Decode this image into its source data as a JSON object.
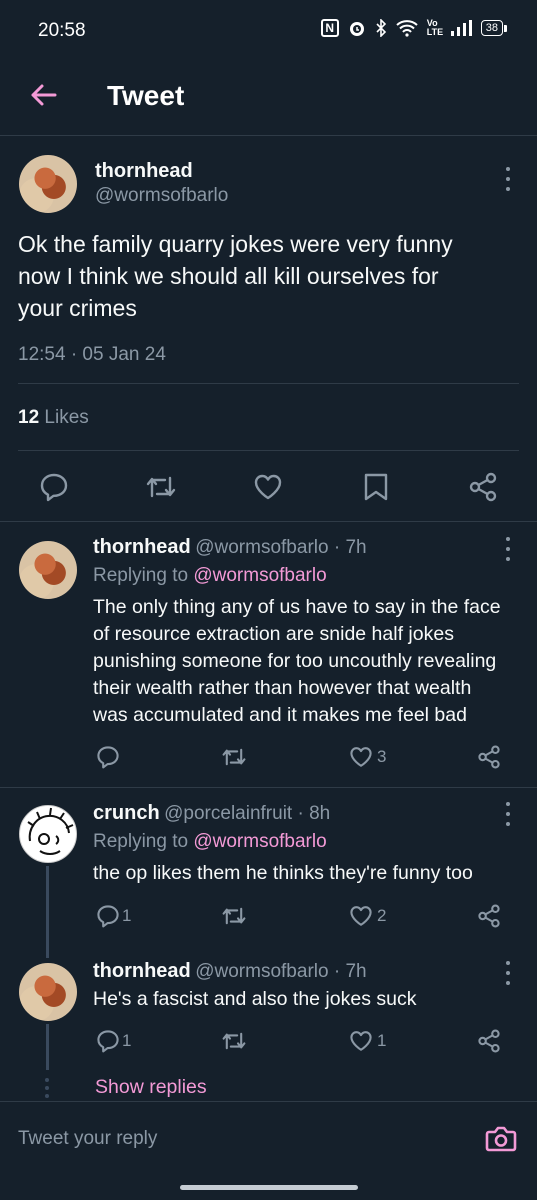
{
  "status_bar": {
    "time": "20:58",
    "battery": "38",
    "lte_label": "Vo LTE"
  },
  "header": {
    "title": "Tweet"
  },
  "main_tweet": {
    "name": "thornhead",
    "handle": "@wormsofbarlo",
    "text_lines": [
      "Ok the family quarry jokes were very funny",
      "now I think we should all kill ourselves for",
      "your crimes"
    ],
    "timestamp": "12:54 · 05 Jan 24",
    "likes_count": "12",
    "likes_label": "Likes"
  },
  "replies": [
    {
      "name": "thornhead",
      "handle": "@wormsofbarlo · 7h",
      "replying_prefix": "Replying to",
      "replying_to": "@wormsofbarlo",
      "text_lines": [
        "The only thing any of us have to say in the face",
        "of resource extraction are snide half jokes",
        "punishing someone for too uncouthly revealing",
        "their wealth rather than however that wealth",
        "was accumulated and it makes me feel bad"
      ],
      "reply_count": "",
      "like_count": "3"
    },
    {
      "name": "crunch",
      "handle": "@porcelainfruit · 8h",
      "replying_prefix": "Replying to",
      "replying_to": "@wormsofbarlo",
      "text_lines": [
        "the op likes them he thinks they're funny too"
      ],
      "reply_count": "1",
      "like_count": "2"
    },
    {
      "name": "thornhead",
      "handle": "@wormsofbarlo · 7h",
      "text_lines": [
        "He's a fascist and also the jokes suck"
      ],
      "reply_count": "1",
      "like_count": "1"
    }
  ],
  "show_replies": "Show replies",
  "composer": {
    "placeholder": "Tweet your reply"
  },
  "colors": {
    "background": "#15202b",
    "accent_pink": "#f39ad6",
    "muted": "#8b98a5",
    "text": "#f7f9f9"
  },
  "icons": [
    "back-arrow-icon",
    "kebab-icon",
    "reply-icon",
    "retweet-icon",
    "heart-icon",
    "bookmark-icon",
    "share-icon",
    "camera-icon"
  ]
}
